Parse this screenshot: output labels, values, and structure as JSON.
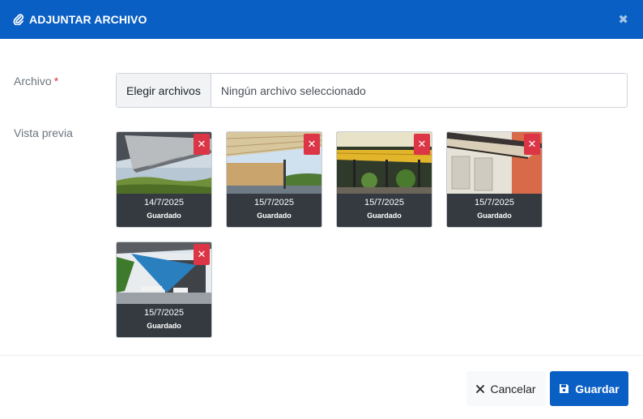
{
  "modal": {
    "title": "ADJUNTAR ARCHIVO",
    "title_icon": "paperclip-icon",
    "close_icon": "close-icon",
    "close_glyph": "✖",
    "header_color": "#0a5fc4"
  },
  "form": {
    "file_label": "Archivo",
    "required_mark": "*",
    "choose_button": "Elegir archivos",
    "no_file_text": "Ningún archivo seleccionado",
    "preview_label": "Vista previa"
  },
  "previews": [
    {
      "date": "14/7/2025",
      "status": "Guardado",
      "delete_glyph": "✕"
    },
    {
      "date": "15/7/2025",
      "status": "Guardado",
      "delete_glyph": "✕"
    },
    {
      "date": "15/7/2025",
      "status": "Guardado",
      "delete_glyph": "✕"
    },
    {
      "date": "15/7/2025",
      "status": "Guardado",
      "delete_glyph": "✕"
    },
    {
      "date": "15/7/2025",
      "status": "Guardado",
      "delete_glyph": "✕"
    }
  ],
  "footer": {
    "cancel_label": "Cancelar",
    "cancel_icon": "times-icon",
    "save_label": "Guardar",
    "save_icon": "floppy-disk-icon",
    "save_color": "#0a5fc4",
    "delete_color": "#dc3545"
  }
}
